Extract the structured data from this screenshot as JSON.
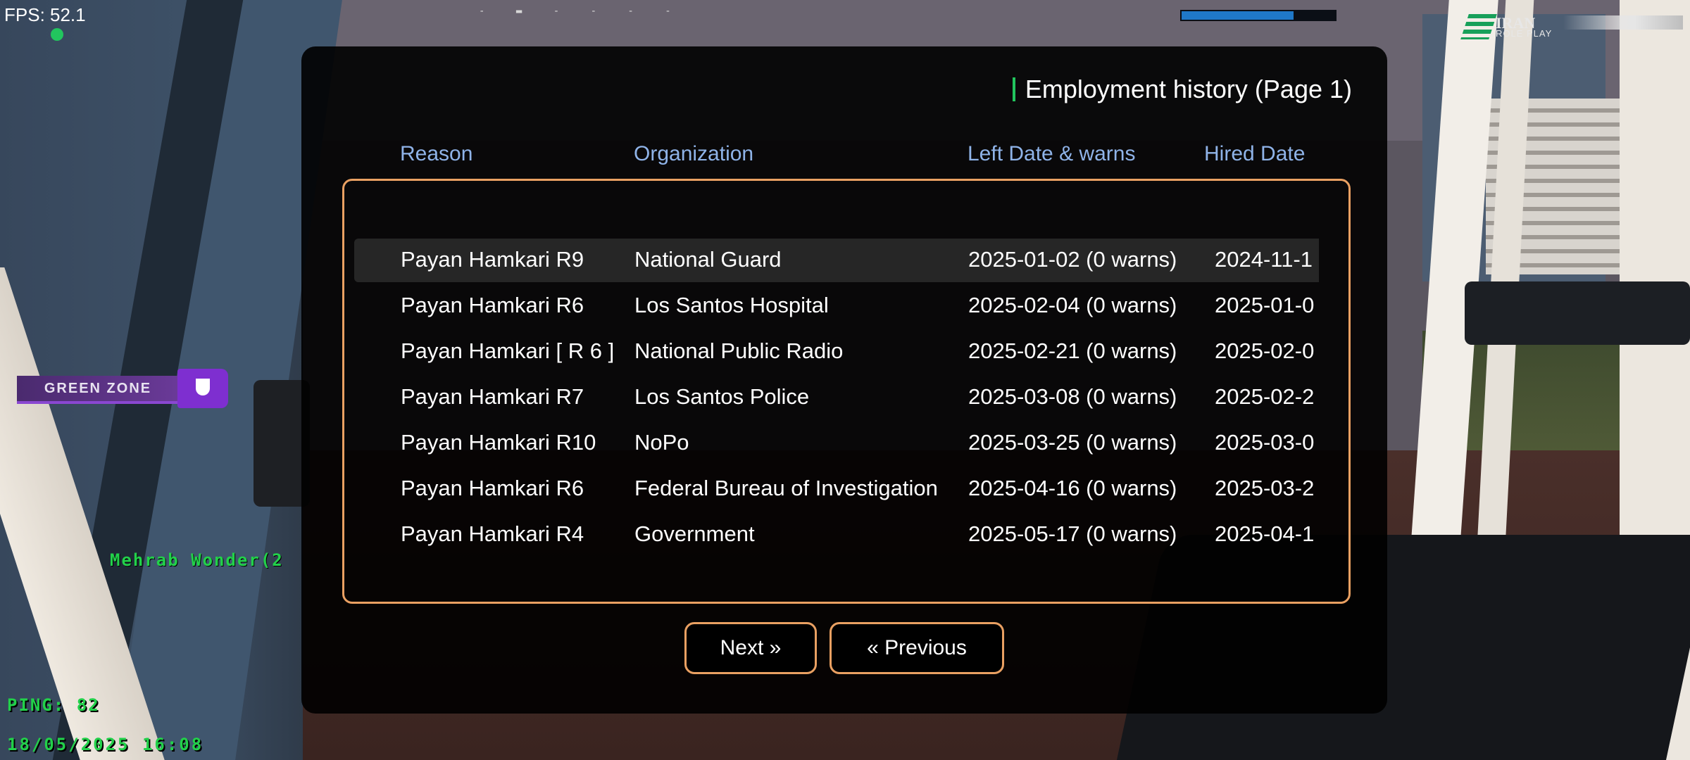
{
  "hud": {
    "fps": "FPS: 52.1",
    "logo_line1": "IRAN",
    "logo_line2": "ROLE PLAY",
    "zone_label": "GREEN ZONE",
    "player_name": "Mehrab Wonder(2",
    "ping": "PING: 82",
    "datetime": "18/05/2025 16:08",
    "top_bar_level": 0.73,
    "colors": {
      "hud_green": "#22d14a",
      "zone_purple": "#7e2fd0",
      "bar_blue": "#1f78c8"
    }
  },
  "dialog": {
    "title": "Employment history (Page 1)",
    "columns": {
      "reason": "Reason",
      "organization": "Organization",
      "left_date": "Left Date & warns",
      "hired_date": "Hired Date"
    },
    "rows": [
      {
        "reason": "Payan Hamkari R9",
        "organization": "National Guard",
        "left": "2025-01-02 (0 warns)",
        "hired": "2024-11-1"
      },
      {
        "reason": "Payan Hamkari R6",
        "organization": "Los Santos Hospital",
        "left": "2025-02-04 (0 warns)",
        "hired": "2025-01-0"
      },
      {
        "reason": "Payan Hamkari [ R 6 ]",
        "organization": "National Public Radio",
        "left": "2025-02-21 (0 warns)",
        "hired": "2025-02-0"
      },
      {
        "reason": "Payan Hamkari R7",
        "organization": "Los Santos Police",
        "left": "2025-03-08 (0 warns)",
        "hired": "2025-02-2"
      },
      {
        "reason": "Payan Hamkari R10",
        "organization": "NoPo",
        "left": "2025-03-25 (0 warns)",
        "hired": "2025-03-0"
      },
      {
        "reason": "Payan Hamkari R6",
        "organization": "Federal Bureau of Investigation",
        "left": "2025-04-16 (0 warns)",
        "hired": "2025-03-2"
      },
      {
        "reason": "Payan Hamkari R4",
        "organization": "Government",
        "left": "2025-05-17 (0 warns)",
        "hired": "2025-04-1"
      }
    ],
    "next_label": "Next »",
    "previous_label": "« Previous",
    "colors": {
      "accent_border": "#e9a062",
      "header_blue": "#8fb3e8",
      "title_bar": "#22c55e"
    }
  }
}
